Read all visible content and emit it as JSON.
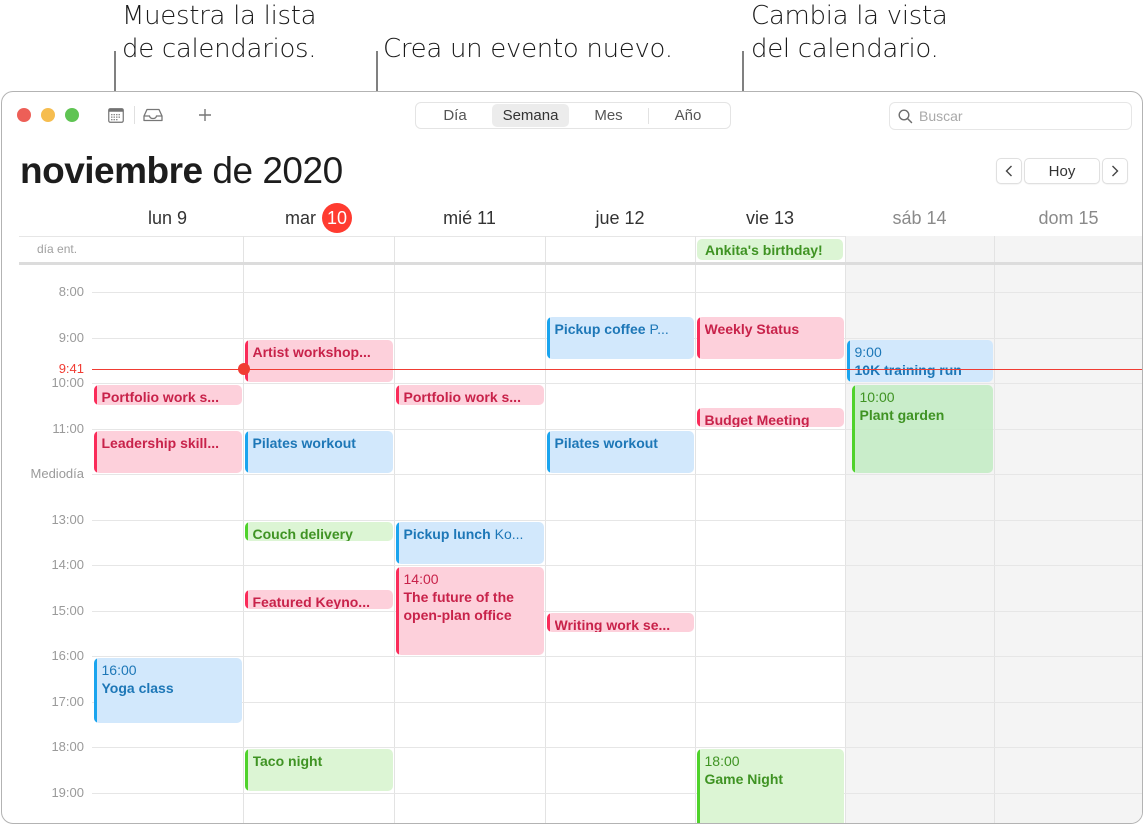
{
  "callouts": {
    "calendar_list": "Muestra la lista\nde calendarios.",
    "calendar_list_line1": "Muestra la lista",
    "calendar_list_line2": "de calendarios.",
    "new_event": "Crea un evento nuevo.",
    "change_view_line1": "Cambia la vista",
    "change_view_line2": "del calendario."
  },
  "toolbar": {
    "calendars_icon": "calendar-list-icon",
    "inbox_icon": "inbox-icon",
    "add_icon": "plus-icon",
    "add_label": "+",
    "views": [
      {
        "label": "Día",
        "active": false
      },
      {
        "label": "Semana",
        "active": true
      },
      {
        "label": "Mes",
        "active": false
      },
      {
        "label": "Año",
        "active": false
      }
    ],
    "search_placeholder": "Buscar"
  },
  "header": {
    "month": "noviembre",
    "rest": " de 2020",
    "prev": "<",
    "today": "Hoy",
    "next": ">"
  },
  "days": [
    {
      "label": "lun 9",
      "weekend": false
    },
    {
      "label": "mar",
      "badge": "10",
      "weekend": false,
      "today": true
    },
    {
      "label": "mié 11",
      "weekend": false
    },
    {
      "label": "jue 12",
      "weekend": false
    },
    {
      "label": "vie 13",
      "weekend": false
    },
    {
      "label": "sáb 14",
      "weekend": true
    },
    {
      "label": "dom 15",
      "weekend": true
    }
  ],
  "allday": {
    "label": "día ent.",
    "events": [
      {
        "day": 4,
        "title": "Ankita's birthday!",
        "color": "green"
      }
    ]
  },
  "hours": [
    "8:00",
    "9:00",
    "10:00",
    "11:00",
    "Mediodía",
    "13:00",
    "14:00",
    "15:00",
    "16:00",
    "17:00",
    "18:00",
    "19:00"
  ],
  "now": {
    "label": "9:41",
    "time": 9.683
  },
  "colors": {
    "red": "#fa2b59",
    "blue": "#1aa4ee",
    "green": "#4fd22b",
    "today": "#ff3b30"
  },
  "events": [
    {
      "day": 0,
      "start": 10.05,
      "end": 10.5,
      "title": "Portfolio work s...",
      "color": "red"
    },
    {
      "day": 0,
      "start": 11.05,
      "end": 12.0,
      "title": "Leadership skill...",
      "color": "red"
    },
    {
      "day": 0,
      "start": 16.05,
      "end": 17.5,
      "time": "16:00",
      "title": "Yoga class",
      "color": "blue",
      "show_time": true
    },
    {
      "day": 1,
      "start": 9.05,
      "end": 10.0,
      "title": "Artist workshop...",
      "color": "red"
    },
    {
      "day": 1,
      "start": 11.05,
      "end": 12.0,
      "title": "Pilates workout",
      "color": "blue"
    },
    {
      "day": 1,
      "start": 13.05,
      "end": 13.5,
      "title": "Couch delivery",
      "color": "green"
    },
    {
      "day": 1,
      "start": 14.55,
      "end": 15.0,
      "title": "Featured Keyno...",
      "color": "red"
    },
    {
      "day": 1,
      "start": 18.05,
      "end": 19.0,
      "title": "Taco night",
      "color": "green"
    },
    {
      "day": 2,
      "start": 10.05,
      "end": 10.5,
      "title": "Portfolio work s...",
      "color": "red"
    },
    {
      "day": 2,
      "start": 13.05,
      "end": 14.0,
      "title": "Pickup lunch",
      "location": "Ko...",
      "color": "blue"
    },
    {
      "day": 2,
      "start": 14.05,
      "end": 16.0,
      "time": "14:00",
      "title": "The future of the open-plan office",
      "color": "red",
      "show_time": true,
      "wrap": true
    },
    {
      "day": 3,
      "start": 8.55,
      "end": 9.5,
      "title": "Pickup coffee",
      "location": "P...",
      "color": "blue"
    },
    {
      "day": 3,
      "start": 11.05,
      "end": 12.0,
      "title": "Pilates workout",
      "color": "blue"
    },
    {
      "day": 3,
      "start": 15.05,
      "end": 15.5,
      "title": "Writing work se...",
      "color": "red"
    },
    {
      "day": 4,
      "start": 8.55,
      "end": 9.5,
      "title": "Weekly Status",
      "color": "red"
    },
    {
      "day": 4,
      "start": 10.55,
      "end": 11.0,
      "title": "Budget Meeting",
      "color": "red"
    },
    {
      "day": 4,
      "start": 18.05,
      "end": 20.0,
      "time": "18:00",
      "title": "Game Night",
      "color": "green",
      "show_time": true
    },
    {
      "day": 5,
      "start": 9.05,
      "end": 10.0,
      "time": "9:00",
      "title": "10K training run",
      "color": "blue",
      "show_time": true
    },
    {
      "day": 5,
      "start": 10.05,
      "end": 12.0,
      "time": "10:00",
      "title": "Plant garden",
      "color": "green",
      "show_time": true,
      "overlap": true
    }
  ]
}
